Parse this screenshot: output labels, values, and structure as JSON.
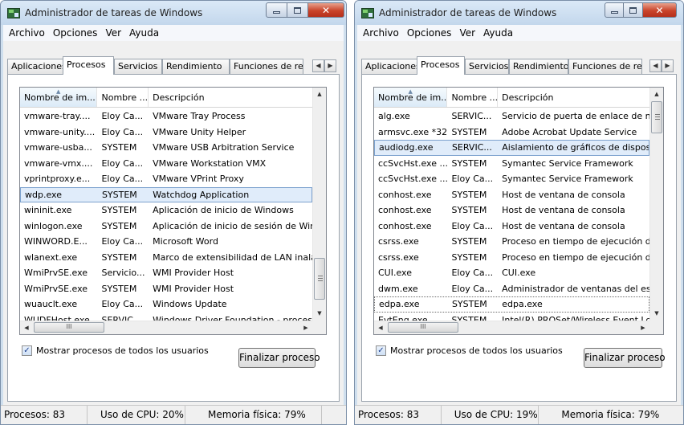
{
  "left": {
    "title": "Administrador de tareas de Windows",
    "menu": [
      "Archivo",
      "Opciones",
      "Ver",
      "Ayuda"
    ],
    "tabs": [
      "Aplicaciones",
      "Procesos",
      "Servicios",
      "Rendimiento",
      "Funciones de red"
    ],
    "active_tab": "Procesos",
    "columns": [
      "Nombre de im...",
      "Nombre ...",
      "Descripción"
    ],
    "rows": [
      [
        "vmware-tray....",
        "Eloy Ca...",
        "VMware Tray Process"
      ],
      [
        "vmware-unity....",
        "Eloy Ca...",
        "VMware Unity Helper"
      ],
      [
        "vmware-usba...",
        "SYSTEM",
        "VMware USB Arbitration Service"
      ],
      [
        "vmware-vmx....",
        "Eloy Ca...",
        "VMware Workstation VMX"
      ],
      [
        "vprintproxy.e...",
        "Eloy Ca...",
        "VMware VPrint Proxy"
      ],
      [
        "wdp.exe",
        "SYSTEM",
        "Watchdog Application"
      ],
      [
        "wininit.exe",
        "SYSTEM",
        "Aplicación de inicio de Windows"
      ],
      [
        "winlogon.exe",
        "SYSTEM",
        "Aplicación de inicio de sesión de Win"
      ],
      [
        "WINWORD.E...",
        "Eloy Ca...",
        "Microsoft Word"
      ],
      [
        "wlanext.exe",
        "SYSTEM",
        "Marco de extensibilidad de LAN inalá"
      ],
      [
        "WmiPrvSE.exe",
        "Servicio...",
        "WMI Provider Host"
      ],
      [
        "WmiPrvSE.exe",
        "SYSTEM",
        "WMI Provider Host"
      ],
      [
        "wuauclt.exe",
        "Eloy Ca...",
        "Windows Update"
      ],
      [
        "WUDFHost.exe",
        "SERVIC...",
        "Windows Driver Foundation - proces"
      ]
    ],
    "selected_row": "wdp.exe",
    "checkbox_label": "Mostrar procesos de todos los usuarios",
    "end_button": "Finalizar proceso",
    "status": {
      "processes": "Procesos: 83",
      "cpu": "Uso de CPU: 20%",
      "memory": "Memoria física: 79%"
    }
  },
  "right": {
    "title": "Administrador de tareas de Windows",
    "menu": [
      "Archivo",
      "Opciones",
      "Ver",
      "Ayuda"
    ],
    "tabs": [
      "Aplicaciones",
      "Procesos",
      "Servicios",
      "Rendimiento",
      "Funciones de red"
    ],
    "active_tab": "Procesos",
    "columns": [
      "Nombre de im...",
      "Nombre ...",
      "Descripción"
    ],
    "rows": [
      [
        "alg.exe",
        "SERVIC...",
        "Servicio de puerta de enlace de nive"
      ],
      [
        "armsvc.exe *32",
        "SYSTEM",
        "Adobe Acrobat Update Service"
      ],
      [
        "audiodg.exe",
        "SERVIC...",
        "Aislamiento de gráficos de dispositiv"
      ],
      [
        "ccSvcHst.exe ...",
        "SYSTEM",
        "Symantec Service Framework"
      ],
      [
        "ccSvcHst.exe ...",
        "Eloy Ca...",
        "Symantec Service Framework"
      ],
      [
        "conhost.exe",
        "SYSTEM",
        "Host de ventana de consola"
      ],
      [
        "conhost.exe",
        "SYSTEM",
        "Host de ventana de consola"
      ],
      [
        "conhost.exe",
        "Eloy Ca...",
        "Host de ventana de consola"
      ],
      [
        "csrss.exe",
        "SYSTEM",
        "Proceso en tiempo de ejecución del"
      ],
      [
        "csrss.exe",
        "SYSTEM",
        "Proceso en tiempo de ejecución del"
      ],
      [
        "CUI.exe",
        "Eloy Ca...",
        "CUI.exe"
      ],
      [
        "dwm.exe",
        "Eloy Ca...",
        "Administrador de ventanas del escri"
      ],
      [
        "edpa.exe",
        "SYSTEM",
        "edpa.exe"
      ],
      [
        "EvtEng.exe",
        "SYSTEM",
        "Intel(R) PROSet/Wireless Event Log"
      ]
    ],
    "selected_row": "audiodg.exe",
    "focused_row": "edpa.exe",
    "checkbox_label": "Mostrar procesos de todos los usuarios",
    "end_button": "Finalizar proceso",
    "status": {
      "processes": "Procesos: 83",
      "cpu": "Uso de CPU: 19%",
      "memory": "Memoria física: 79%"
    }
  },
  "icons": {
    "app": "task-manager-icon",
    "minimize": "minimize-icon",
    "maximize": "maximize-icon",
    "close": "close-icon",
    "checkbox_state": "checked"
  },
  "colors": {
    "title_bg": "#c3d7ec",
    "close_red": "#c9432a",
    "selection": "#e0ecfa",
    "selection_border": "#7da2ce"
  }
}
